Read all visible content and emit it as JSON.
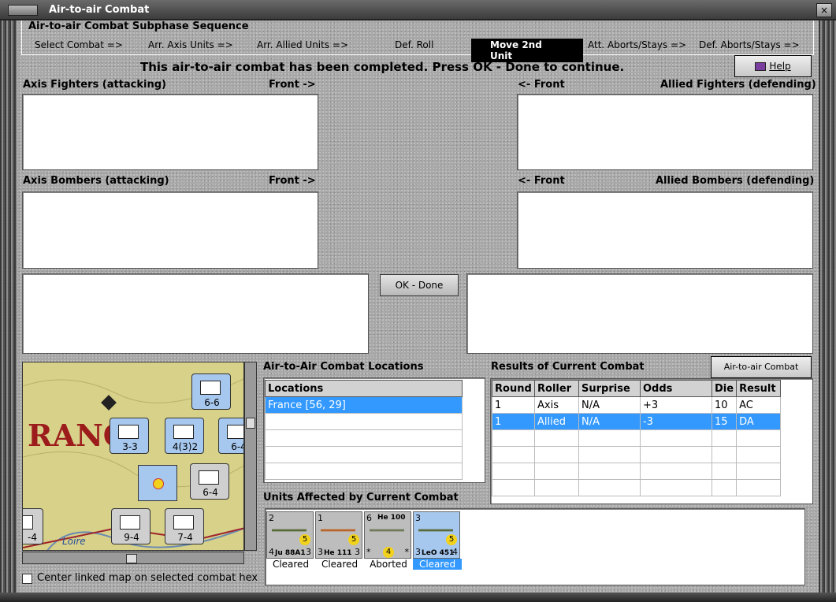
{
  "window": {
    "title": "Air-to-air Combat",
    "close_glyph": "×"
  },
  "sequence": {
    "title": "Air-to-air Combat Subphase Sequence",
    "steps": [
      "Select Combat =>",
      "Arr. Axis Units =>",
      "Arr. Allied Units =>",
      "Def. Roll",
      "Move 2nd Unit",
      "Att. Aborts/Stays =>",
      "Def. Aborts/Stays =>"
    ],
    "active_index": 4
  },
  "status_message": "This air-to-air combat has been completed.  Press OK - Done to continue.",
  "help_label": "Help",
  "panels": {
    "axis_fighters": "Axis Fighters (attacking)",
    "axis_fighters_front": "Front ->",
    "allied_fighters_front": "<- Front",
    "allied_fighters": "Allied Fighters (defending)",
    "axis_bombers": "Axis Bombers (attacking)",
    "axis_bombers_front": "Front ->",
    "allied_bombers_front": "<- Front",
    "allied_bombers": "Allied Bombers (defending)"
  },
  "ok_label": "OK - Done",
  "map": {
    "country_text": "RANC",
    "river_text": "Loire",
    "counters": [
      {
        "val": "6-6"
      },
      {
        "val": "3-3"
      },
      {
        "val": "4(3)2"
      },
      {
        "val": "6-4"
      },
      {
        "val": "6-4"
      },
      {
        "val": "9-4"
      },
      {
        "val": "7-4"
      },
      {
        "val": "6-4"
      },
      {
        "val": "-4"
      }
    ],
    "center_label": "Center linked map on selected combat hex"
  },
  "locations": {
    "section": "Air-to-Air Combat Locations",
    "header": "Locations",
    "items": [
      "France [56, 29]"
    ]
  },
  "results": {
    "section": "Results of Current Combat",
    "chart_button": "Air-to-air Combat Chart",
    "columns": [
      "Round",
      "Roller",
      "Surprise",
      "Odds",
      "Die",
      "Result"
    ],
    "rows": [
      [
        "1",
        "Axis",
        "N/A",
        "+3",
        "10",
        "AC"
      ],
      [
        "1",
        "Allied",
        "N/A",
        "-3",
        "15",
        "DA"
      ]
    ]
  },
  "units": {
    "section": "Units Affected by Current Combat",
    "items": [
      {
        "name": "Ju 88A1",
        "tl": "2",
        "bl": "4",
        "br": "3",
        "badge": "5",
        "status": "Cleared"
      },
      {
        "name": "He 111",
        "tl": "1",
        "bl": "3",
        "br": "3",
        "badge": "5",
        "status": "Cleared"
      },
      {
        "name": "He 100",
        "tl": "6",
        "bl": "*",
        "br": "*",
        "badge": "4",
        "status": "Aborted"
      },
      {
        "name": "LeO 451",
        "tl": "3",
        "bl": "3",
        "br": "4",
        "badge": "5",
        "status": "Cleared"
      }
    ]
  }
}
